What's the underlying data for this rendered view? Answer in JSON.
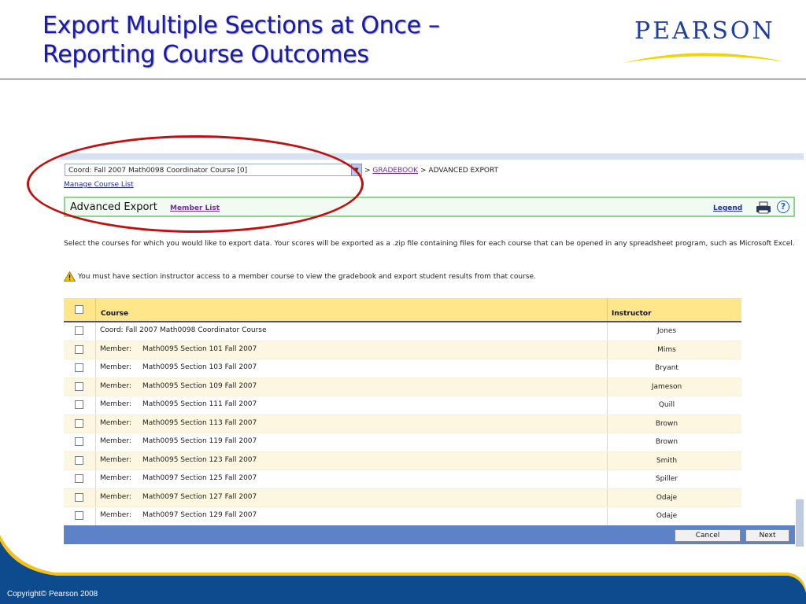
{
  "slide": {
    "title_line1": "Export Multiple Sections at Once –",
    "title_line2": "Reporting Course Outcomes",
    "logo_text": "PEARSON",
    "copyright": "Copyright© Pearson 2008"
  },
  "app": {
    "course_select": "Coord: Fall 2007 Math0098 Coordinator Course [0]",
    "breadcrumb_sep1": ">",
    "breadcrumb_link": "GRADEBOOK",
    "breadcrumb_current": "> ADVANCED EXPORT",
    "manage_course_list": "Manage Course List",
    "page_title": "Advanced Export",
    "member_list_link": "Member List",
    "legend_link": "Legend",
    "help_label": "?",
    "instructions": "Select the courses for which you would like to export data. Your scores will be exported as a .zip file containing files for each course that can be opened in any spreadsheet program, such as Microsoft Excel.",
    "warning": "You must have section instructor access to a member course to view the gradebook and export student results from that course.",
    "table": {
      "header_course": "Course",
      "header_instructor": "Instructor",
      "rows": [
        {
          "prefix": "Coord: Fall 2007 Math0098 Coordinator Course",
          "name": "",
          "instructor": "Jones"
        },
        {
          "prefix": "Member:",
          "name": "Math0095 Section 101 Fall 2007",
          "instructor": "Mims"
        },
        {
          "prefix": "Member:",
          "name": "Math0095 Section 103 Fall 2007",
          "instructor": "Bryant"
        },
        {
          "prefix": "Member:",
          "name": "Math0095 Section 109 Fall 2007",
          "instructor": "Jameson"
        },
        {
          "prefix": "Member:",
          "name": "Math0095 Section 111 Fall 2007",
          "instructor": "Quill"
        },
        {
          "prefix": "Member:",
          "name": "Math0095 Section 113 Fall 2007",
          "instructor": "Brown"
        },
        {
          "prefix": "Member:",
          "name": "Math0095 Section 119 Fall 2007",
          "instructor": "Brown"
        },
        {
          "prefix": "Member:",
          "name": "Math0095 Section 123 Fall 2007",
          "instructor": "Smith"
        },
        {
          "prefix": "Member:",
          "name": "Math0097 Section 125 Fall 2007",
          "instructor": "Spiller"
        },
        {
          "prefix": "Member:",
          "name": "Math0097 Section 127 Fall 2007",
          "instructor": "Odaje"
        },
        {
          "prefix": "Member:",
          "name": "Math0097 Section 129 Fall 2007",
          "instructor": "Odaje"
        }
      ]
    },
    "cancel_button": "Cancel",
    "next_button": "Next"
  },
  "colors": {
    "title_blue": "#1a1aa8",
    "annotation_red": "#c21010",
    "header_yellow": "#ffe68a",
    "footer_blue": "#5e82c8",
    "deco_navy": "#0e4a8e",
    "deco_gold": "#f2c21a"
  },
  "icons": [
    "chevron-down-icon",
    "printer-icon",
    "help-icon",
    "warning-icon"
  ]
}
